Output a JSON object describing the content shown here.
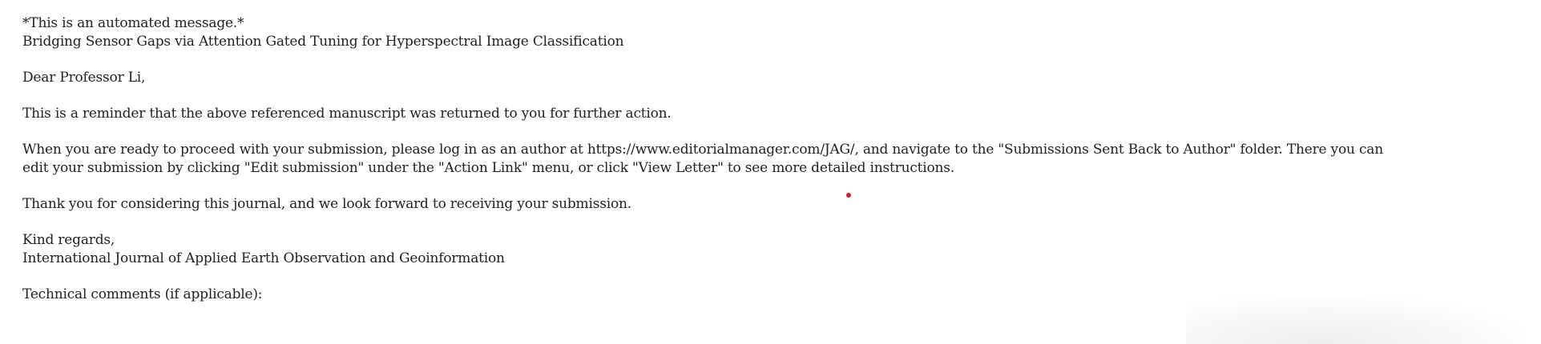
{
  "email": {
    "automated_notice": "*This is an automated message.*",
    "manuscript_title": "Bridging Sensor Gaps via Attention Gated Tuning for Hyperspectral Image Classification",
    "greeting": "Dear Professor Li,",
    "reminder": "This is a reminder that the above referenced manuscript was returned to you for further action.",
    "instructions_line1": "When you are ready to proceed with your submission, please log in as an author at https://www.editorialmanager.com/JAG/, and navigate to the \"Submissions Sent Back to Author\" folder. There you can",
    "instructions_line2": "edit your submission by clicking \"Edit submission\" under the \"Action Link\" menu, or click \"View Letter\" to see more detailed instructions.",
    "thanks": "Thank you for considering this journal, and we look forward to receiving your submission.",
    "closing": "Kind regards,",
    "signature": "International Journal of Applied Earth Observation and Geoinformation",
    "technical_comments_label": "Technical comments (if applicable):"
  },
  "colors": {
    "text": "#222222",
    "background": "#ffffff",
    "marker_dot": "#d81e1e"
  }
}
